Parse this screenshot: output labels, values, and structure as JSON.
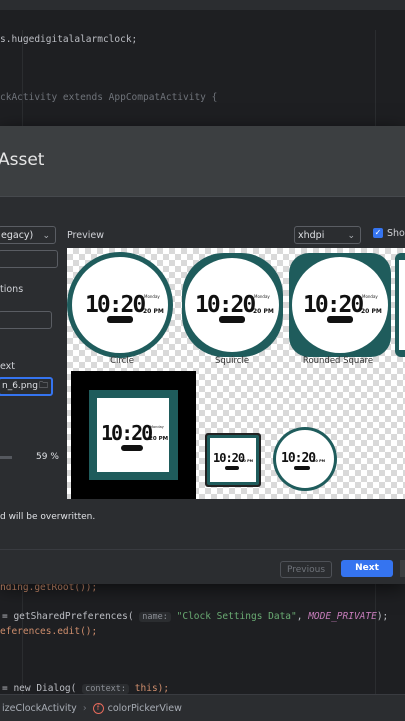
{
  "editor": {
    "line_package": "s.hugedigitalalarmclock;",
    "line_class": "ckActivity extends AppCompatActivity {",
    "line_getroot": "nding.getRoot());",
    "line_prefs_eq": "= getSharedPreferences(",
    "line_prefs_hint": "name:",
    "line_prefs_str": "\"Clock Settings Data\"",
    "line_prefs_mode": "MODE_PRIVATE",
    "line_prefs_end": ");",
    "line_edit": "eferences.edit();",
    "line_dialog_eq": "= new Dialog(",
    "line_dialog_hint": "context:",
    "line_dialog_end": "this);"
  },
  "status_bar": {
    "class_crumb": "izeClockActivity",
    "method_crumb": "colorPickerView"
  },
  "dialog": {
    "title": "Asset",
    "type_dropdown": "egacy)",
    "options_label": "tions",
    "path_label": "ext",
    "path_value": "n_6.png",
    "scale_percent": "59 %",
    "preview_label": "Preview",
    "density_dropdown": "xhdpi",
    "show_checkbox_label": "Shov",
    "footer_message": "d will be overwritten.",
    "previous_button": "Previous",
    "next_button": "Next",
    "icons": [
      {
        "label": "Circle",
        "shape": "circle"
      },
      {
        "label": "Squircle",
        "shape": "squircle"
      },
      {
        "label": "Rounded Square",
        "shape": "rounded"
      },
      {
        "label": "",
        "shape": "full-bleed"
      },
      {
        "label": "",
        "shape": "square-small"
      },
      {
        "label": "",
        "shape": "circle-small"
      }
    ],
    "clock_time": "10:20",
    "clock_ampm": "20 PM",
    "clock_day": "Monday"
  },
  "colors": {
    "accent": "#3574f0",
    "teal": "#1f5c5c",
    "dialog_bg": "#2b2d30",
    "header_bg": "#3c3f41"
  }
}
